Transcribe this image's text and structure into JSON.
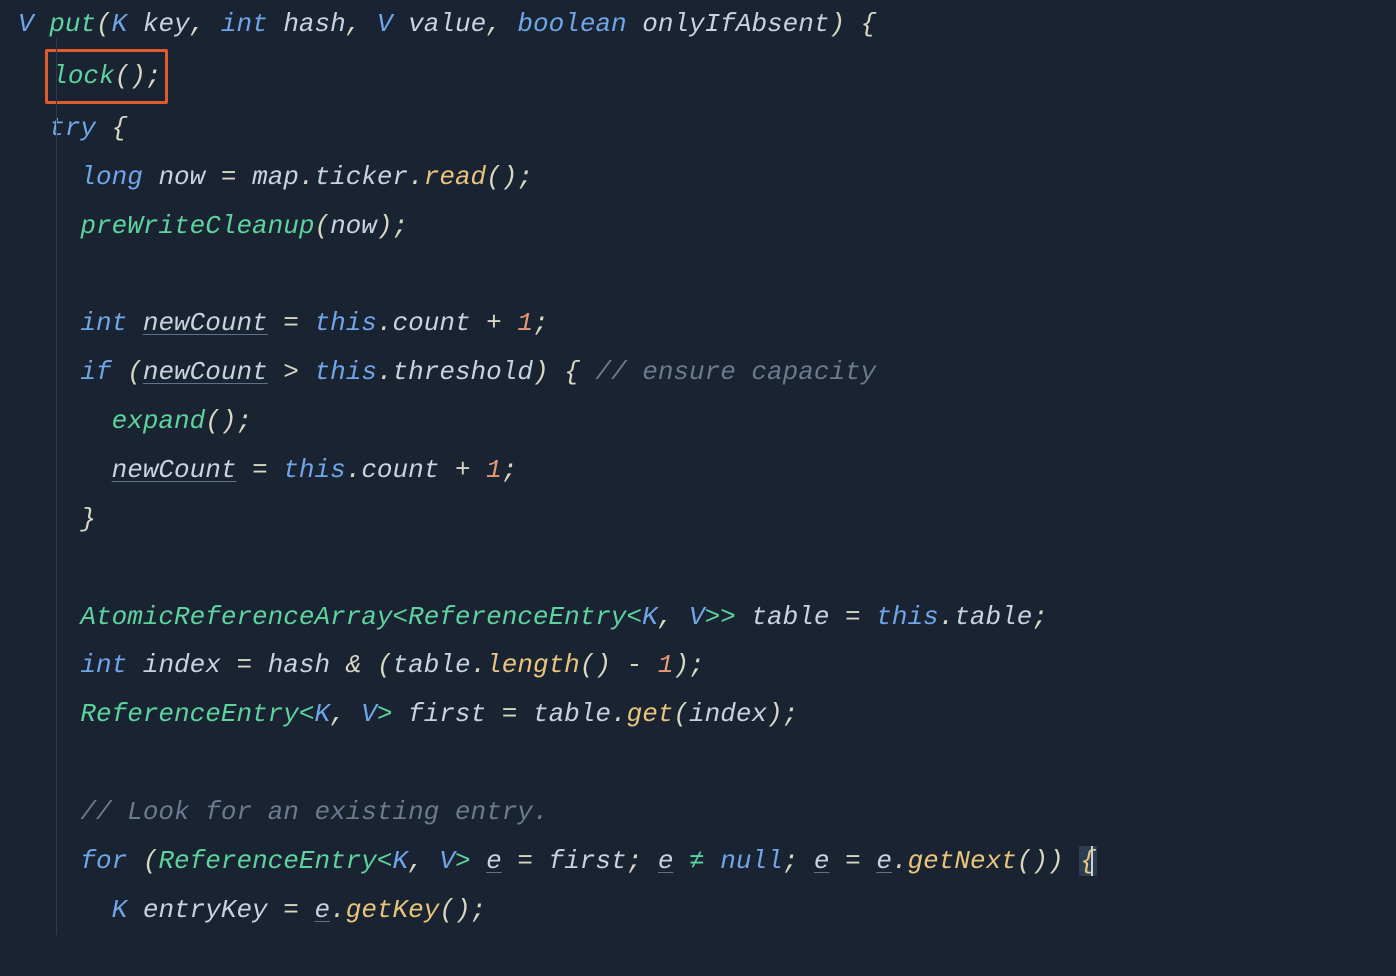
{
  "code": {
    "line1": {
      "type_V": "V",
      "method": "put",
      "p1_type": "K",
      "p1_name": "key",
      "p2_type": "int",
      "p2_name": "hash",
      "p3_type": "V",
      "p3_name": "value",
      "p4_type": "boolean",
      "p4_name": "onlyIfAbsent"
    },
    "line2": {
      "lock": "lock"
    },
    "line3": {
      "try_kw": "try"
    },
    "line4": {
      "type": "long",
      "var": "now",
      "obj": "map",
      "prop": "ticker",
      "call": "read"
    },
    "line5": {
      "call": "preWriteCleanup",
      "arg": "now"
    },
    "line7": {
      "type": "int",
      "var": "newCount",
      "this": "this",
      "prop": "count",
      "num": "1"
    },
    "line8": {
      "if_kw": "if",
      "var": "newCount",
      "this": "this",
      "prop": "threshold",
      "comment": "// ensure capacity"
    },
    "line9": {
      "call": "expand"
    },
    "line10": {
      "var": "newCount",
      "this": "this",
      "prop": "count",
      "num": "1"
    },
    "line13": {
      "class1": "AtomicReferenceArray",
      "class2": "ReferenceEntry",
      "g1": "K",
      "g2": "V",
      "var": "table",
      "this": "this",
      "prop": "table"
    },
    "line14": {
      "type": "int",
      "var": "index",
      "hash": "hash",
      "tbl": "table",
      "call": "length",
      "num": "1"
    },
    "line15": {
      "class": "ReferenceEntry",
      "g1": "K",
      "g2": "V",
      "var": "first",
      "tbl": "table",
      "call": "get",
      "arg": "index"
    },
    "line17": {
      "comment": "// Look for an existing entry."
    },
    "line18": {
      "for_kw": "for",
      "class": "ReferenceEntry",
      "g1": "K",
      "g2": "V",
      "e": "e",
      "first": "first",
      "null": "null",
      "call": "getNext"
    },
    "line19": {
      "type": "K",
      "var": "entryKey",
      "e": "e",
      "call": "getKey"
    }
  }
}
